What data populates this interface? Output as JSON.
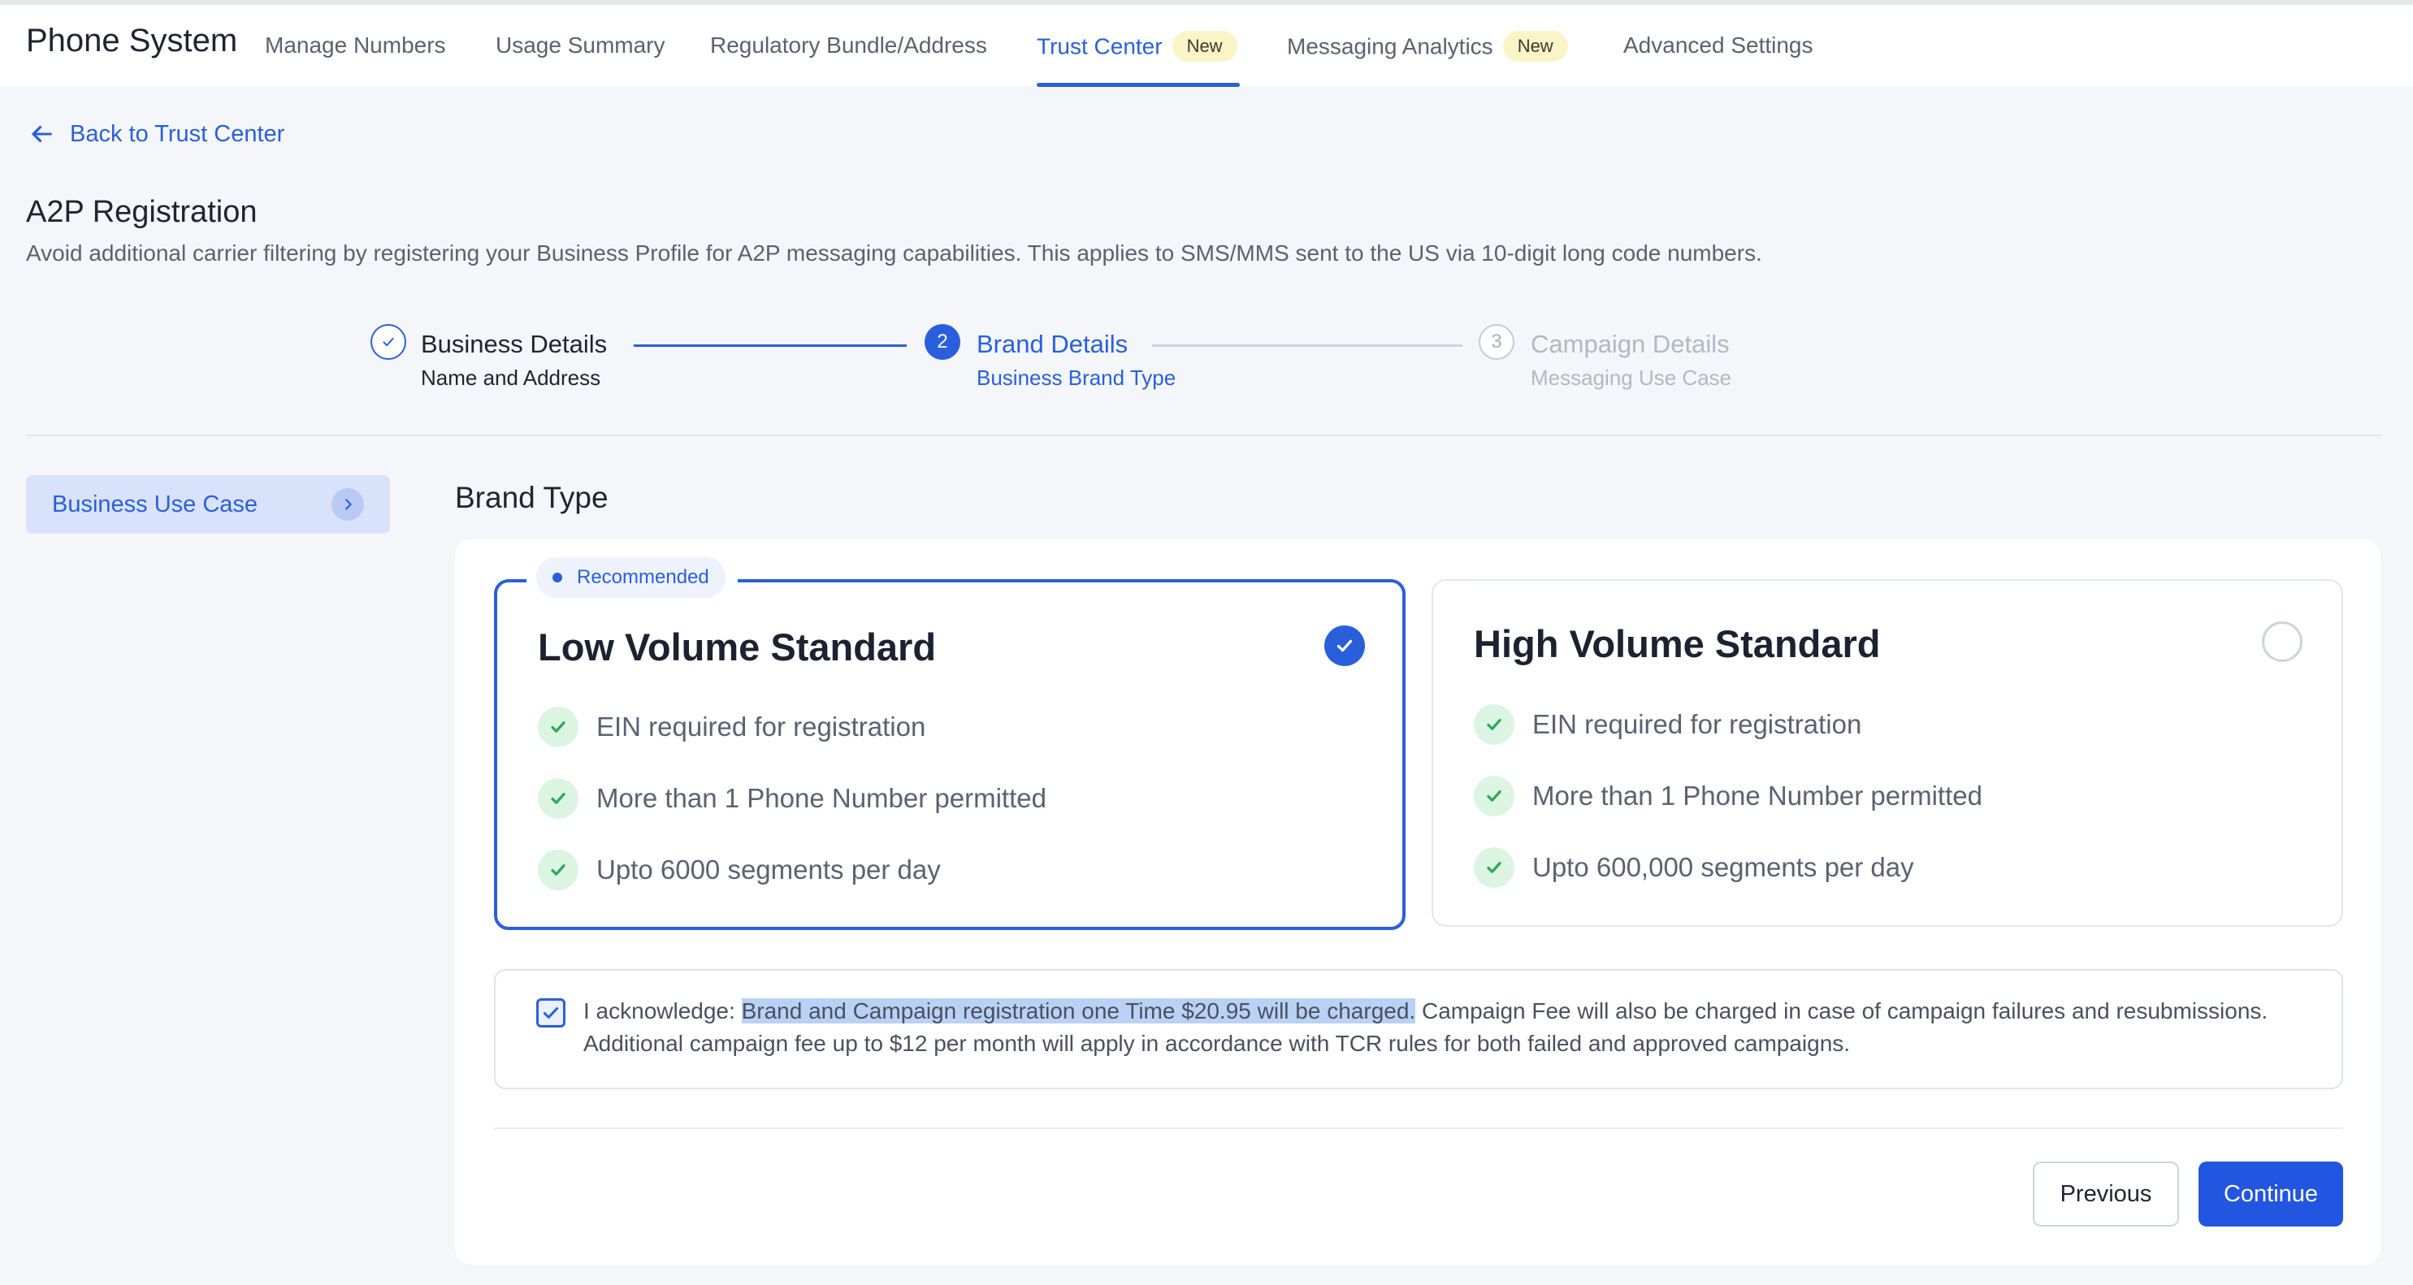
{
  "app": {
    "title": "Phone System"
  },
  "nav": {
    "tabs": [
      {
        "label": "Manage Numbers"
      },
      {
        "label": "Usage Summary"
      },
      {
        "label": "Regulatory Bundle/Address"
      },
      {
        "label": "Trust Center",
        "badge": "New",
        "active": true
      },
      {
        "label": "Messaging Analytics",
        "badge": "New"
      },
      {
        "label": "Advanced Settings"
      }
    ]
  },
  "back_link": {
    "label": "Back to Trust Center",
    "icon": "arrow-left-icon"
  },
  "page": {
    "title": "A2P Registration",
    "description": "Avoid additional carrier filtering by registering your Business Profile for A2P messaging capabilities. This applies to SMS/MMS sent to the US via 10-digit long code numbers."
  },
  "stepper": {
    "steps": [
      {
        "number": "1",
        "title": "Business Details",
        "subtitle": "Name and Address",
        "status": "completed"
      },
      {
        "number": "2",
        "title": "Brand Details",
        "subtitle": "Business Brand Type",
        "status": "active"
      },
      {
        "number": "3",
        "title": "Campaign Details",
        "subtitle": "Messaging Use Case",
        "status": "pending"
      }
    ]
  },
  "sidebar": {
    "items": [
      {
        "label": "Business Use Case",
        "icon": "chevron-right-icon"
      }
    ]
  },
  "brand_type": {
    "section_title": "Brand Type",
    "recommended_label": "Recommended",
    "options": [
      {
        "title": "Low Volume Standard",
        "selected": true,
        "features": [
          "EIN required for registration",
          "More than 1 Phone Number permitted",
          "Upto 6000 segments per day"
        ]
      },
      {
        "title": "High Volume Standard",
        "selected": false,
        "features": [
          "EIN required for registration",
          "More than 1 Phone Number permitted",
          "Upto 600,000 segments per day"
        ]
      }
    ]
  },
  "acknowledgement": {
    "checked": true,
    "prefix": "I acknowledge: ",
    "highlighted": "Brand and Campaign registration one Time $20.95 will be charged.",
    "rest": " Campaign Fee will also be charged in case of campaign failures and resubmissions. Additional campaign fee up to $12 per month will apply in accordance with TCR rules for both failed and approved campaigns."
  },
  "footer": {
    "previous_label": "Previous",
    "continue_label": "Continue"
  },
  "colors": {
    "accent": "#2a5fdc",
    "primary_button": "#2356e0",
    "badge_bg": "#fbf4c6",
    "check_green": "#2fa75a"
  }
}
